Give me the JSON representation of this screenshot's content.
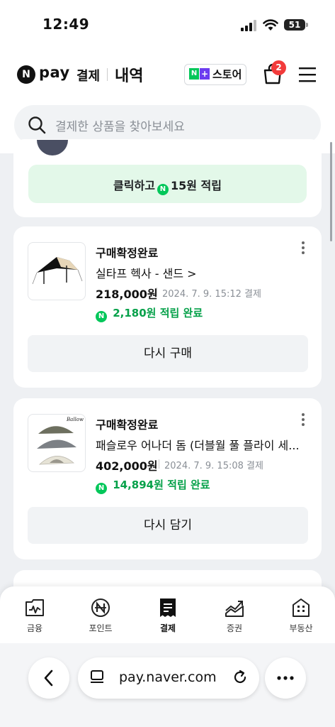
{
  "status_bar": {
    "time": "12:49",
    "battery": "51"
  },
  "header": {
    "logo_n": "N",
    "logo_pay": "pay",
    "logo_payment": "결제",
    "title": "내역",
    "store_n": "N",
    "store_plus": "+",
    "store_label": "스토어",
    "cart_badge": "2"
  },
  "search": {
    "placeholder": "결제한 상품을 찾아보세요"
  },
  "promo": {
    "text_before": "클릭하고",
    "coin": "N",
    "text_after": "15원 적립"
  },
  "orders": [
    {
      "status": "구매확정완료",
      "product": "실타프 헥사 - 샌드 >",
      "price": "218,000원",
      "date": "2024. 7. 9. 15:12 결제",
      "points": "2,180원 적립 완료",
      "action": "다시 구매"
    },
    {
      "status": "구매확정완료",
      "product": "패슬로우 어나더 돔 (더블월 풀 플라이 세... >",
      "price": "402,000원",
      "date": "2024. 7. 9. 15:08 결제",
      "points": "14,894원 적립 완료",
      "action": "다시 담기"
    }
  ],
  "bottom_nav": [
    {
      "label": "금융",
      "icon": "finance-icon",
      "active": false
    },
    {
      "label": "포인트",
      "icon": "point-icon",
      "active": false
    },
    {
      "label": "결제",
      "icon": "receipt-icon",
      "active": true
    },
    {
      "label": "증권",
      "icon": "stock-chart-icon",
      "active": false
    },
    {
      "label": "부동산",
      "icon": "building-icon",
      "active": false
    }
  ],
  "browser": {
    "url": "pay.naver.com"
  },
  "colors": {
    "green": "#03c75a",
    "points_green": "#06a14a",
    "badge_red": "#f23b3b",
    "store_purple": "#6c3cf0"
  }
}
